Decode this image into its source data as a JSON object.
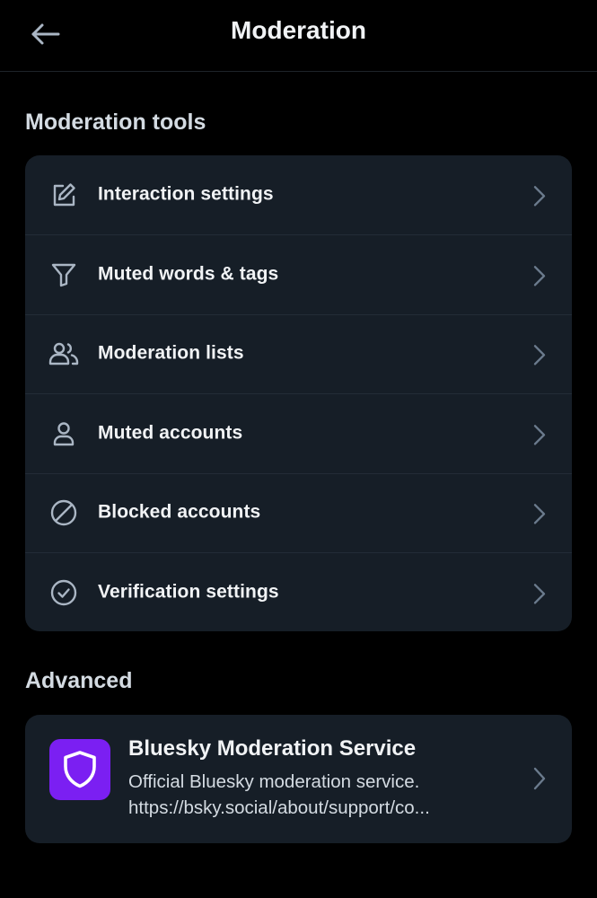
{
  "header": {
    "title": "Moderation",
    "back_icon": "arrow-left-icon"
  },
  "tools_section": {
    "title": "Moderation tools",
    "items": [
      {
        "label": "Interaction settings",
        "icon": "edit-icon"
      },
      {
        "label": "Muted words & tags",
        "icon": "filter-icon"
      },
      {
        "label": "Moderation lists",
        "icon": "users-icon"
      },
      {
        "label": "Muted accounts",
        "icon": "person-icon"
      },
      {
        "label": "Blocked accounts",
        "icon": "block-icon"
      },
      {
        "label": "Verification settings",
        "icon": "check-circle-icon"
      }
    ]
  },
  "advanced_section": {
    "title": "Advanced",
    "service": {
      "name": "Bluesky Moderation Service",
      "description_line1": "Official Bluesky moderation service.",
      "description_line2": "https://bsky.social/about/support/co...",
      "icon": "shield-icon",
      "avatar_color": "#7b1ff2"
    }
  },
  "colors": {
    "background": "#000000",
    "card": "#161e27",
    "text_primary": "#f1f3f5",
    "text_secondary": "#d4dbe2",
    "icon": "#aab6c4",
    "chevron": "#6b7b8d"
  }
}
